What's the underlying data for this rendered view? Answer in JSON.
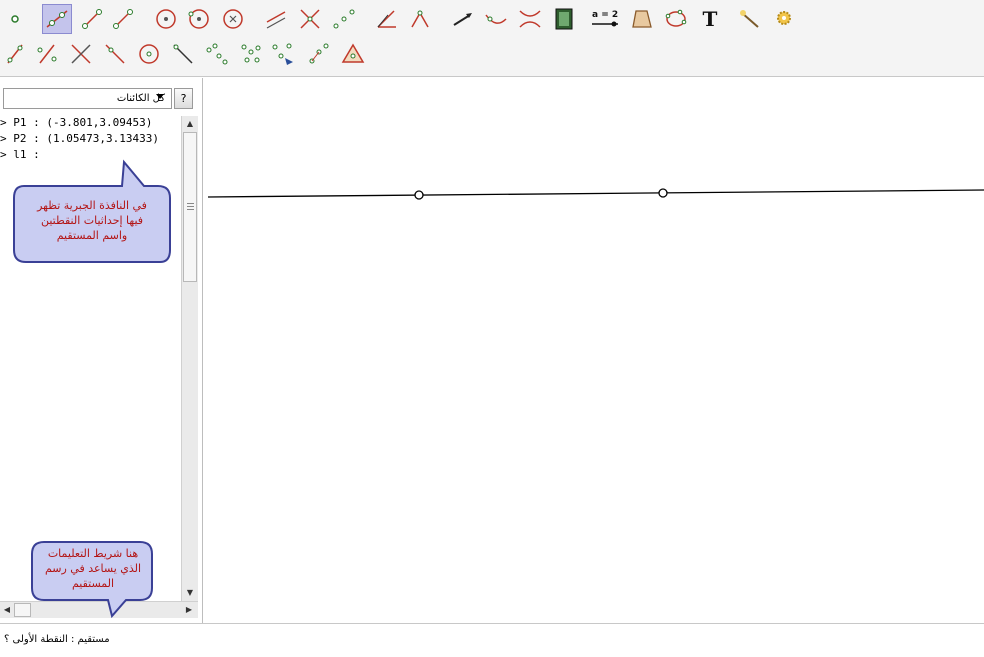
{
  "toolbar": {
    "row1": [
      "point-tool",
      "line-through-two-points-tool",
      "segment-tool",
      "vector-tool",
      "circle-center-point-tool",
      "circle-through-points-tool",
      "circle-center-radius-tool",
      "parallel-line-tool",
      "intersect-tool",
      "midpoint-tool",
      "angle-bisector-tool",
      "angle-tool",
      "vector-from-point-tool",
      "locus-tool",
      "reflect-tool",
      "animation-tool",
      "slider-tool",
      "polygon-tool",
      "conic-tool",
      "text-tool",
      "move-view-tool",
      "settings-tool"
    ],
    "row2": [
      "perpendicular-line-tool",
      "perpendicular-bisector-tool",
      "line-intersect-tool",
      "tangent-tool",
      "circle-tool",
      "polar-line-tool",
      "compass-tool",
      "relation-tool",
      "locus-points-tool",
      "dilate-tool",
      "translate-tool",
      "triangle-tool"
    ],
    "slider_label": "a = 2",
    "text_tool_label": "T"
  },
  "algebra": {
    "filter_label": "كل الكائنات",
    "help_label": "?",
    "rows": [
      "> P1 : (-3.801,3.09453)",
      "> P2 : (1.05473,3.13433)",
      "> l1 :"
    ]
  },
  "callouts": {
    "algebra_note": [
      "في النافذة الجبرية تظهر",
      "فيها إحداثيات النقطتين",
      "واسم المستقيم"
    ],
    "status_note": [
      "هنا شريط التعليمات",
      "الذي يساعد في رسم",
      "المستقيم"
    ]
  },
  "status_bar": {
    "text": "مستقيم : النقطة الأولى ؟"
  },
  "colors": {
    "callout_fill": "#c9cdf2",
    "callout_border": "#3a4096",
    "callout_text": "#b31414",
    "selected_tool": "#c4c4ec"
  }
}
